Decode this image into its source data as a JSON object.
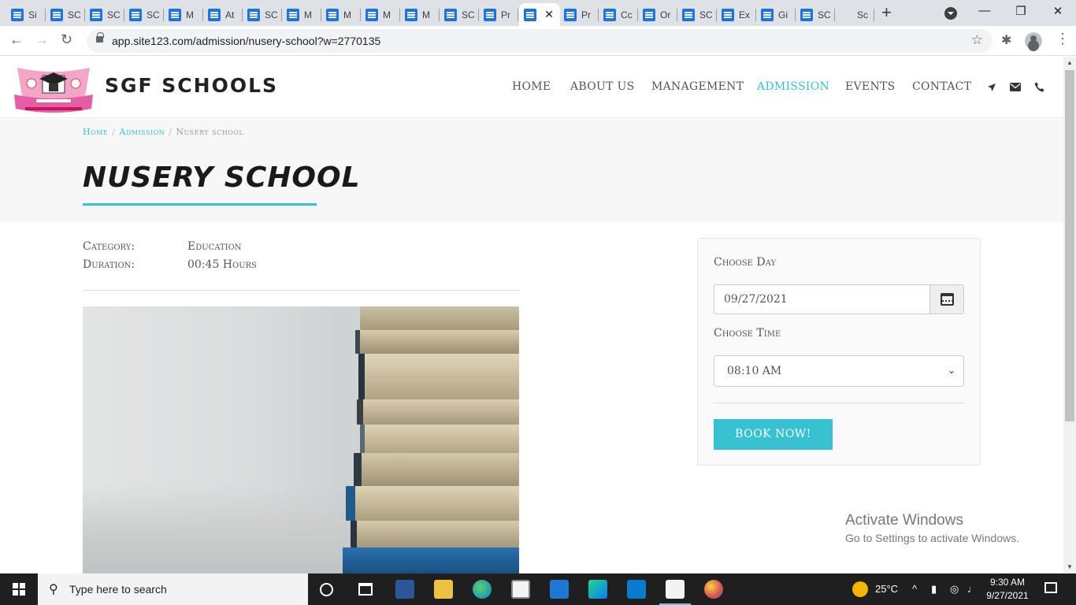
{
  "browser": {
    "tabs": [
      {
        "label": "Si",
        "icon": "docs"
      },
      {
        "label": "SC",
        "icon": "docs"
      },
      {
        "label": "SC",
        "icon": "docs"
      },
      {
        "label": "SC",
        "icon": "docs"
      },
      {
        "label": "M",
        "icon": "docs"
      },
      {
        "label": "At",
        "icon": "docs"
      },
      {
        "label": "SC",
        "icon": "docs"
      },
      {
        "label": "M",
        "icon": "docs"
      },
      {
        "label": "M",
        "icon": "docs"
      },
      {
        "label": "M",
        "icon": "docs"
      },
      {
        "label": "M",
        "icon": "docs"
      },
      {
        "label": "SC",
        "icon": "docs"
      },
      {
        "label": "Pr",
        "icon": "docs"
      },
      {
        "label": "",
        "icon": "docs",
        "active": true
      },
      {
        "label": "Pr",
        "icon": "docs"
      },
      {
        "label": "Cc",
        "icon": "docs"
      },
      {
        "label": "Or",
        "icon": "docs"
      },
      {
        "label": "SC",
        "icon": "docs"
      },
      {
        "label": "Ex",
        "icon": "docs"
      },
      {
        "label": "Gi",
        "icon": "docs"
      },
      {
        "label": "SC",
        "icon": "docs"
      },
      {
        "label": "Sc",
        "icon": "photos"
      }
    ],
    "close_glyph": "✕",
    "new_tab_glyph": "+",
    "url": "app.site123.com/admission/nusery-school?w=2770135",
    "window_controls": {
      "minimize": "—",
      "restore": "❐",
      "close": "✕"
    },
    "nav": {
      "back": "←",
      "forward": "→",
      "reload": "↻"
    },
    "bookmark_glyph": "☆",
    "extensions_glyph": "✱",
    "menu_glyph": "⋮"
  },
  "site": {
    "brand": "SGF SCHOOLS",
    "logo_text": {
      "top": "S.G.F",
      "ribbon": "PRIVATE SCHOOL"
    },
    "nav": [
      {
        "label": "HOME"
      },
      {
        "label": "ABOUT US"
      },
      {
        "label": "MANAGEMENT"
      },
      {
        "label": "ADMISSION",
        "active": true
      },
      {
        "label": "EVENTS"
      },
      {
        "label": "CONTACT"
      }
    ],
    "header_icons": [
      "location-arrow-icon",
      "envelope-icon",
      "phone-icon"
    ],
    "breadcrumb": {
      "home": "Home",
      "section": "Admission",
      "current": "Nusery school"
    },
    "title": "NUSERY SCHOOL",
    "meta": {
      "category_label": "Category:",
      "category_value": "Education",
      "duration_label": "Duration:",
      "duration_value": "00:45 Hours"
    },
    "booking": {
      "day_label": "Choose Day",
      "date_value": "09/27/2021",
      "time_label": "Choose Time",
      "time_value": "08:10 AM",
      "button": "BOOK NOW!"
    },
    "accent_color": "#38c1d0"
  },
  "watermark": {
    "line1": "Activate Windows",
    "line2": "Go to Settings to activate Windows."
  },
  "taskbar": {
    "search_placeholder": "Type here to search",
    "weather": "25°C",
    "time": "9:30 AM",
    "date": "9/27/2021"
  }
}
